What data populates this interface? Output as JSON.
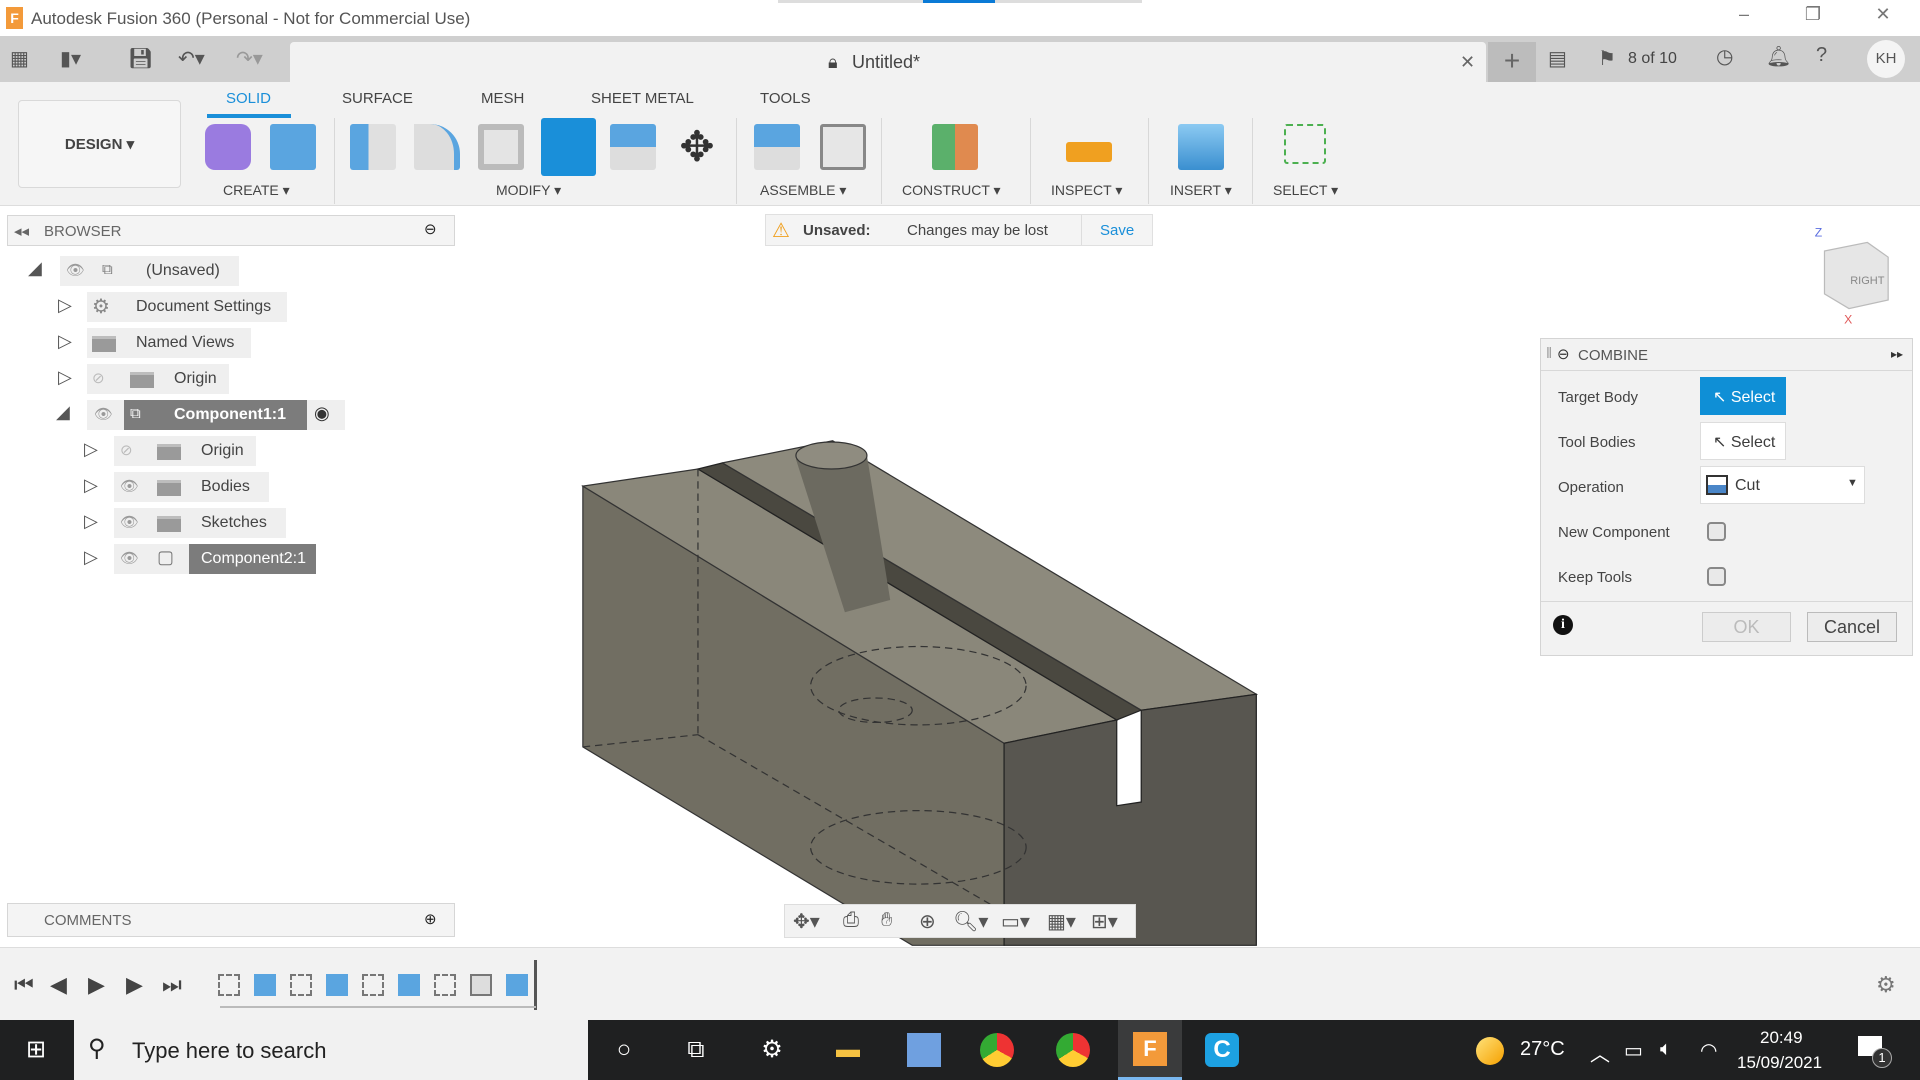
{
  "window": {
    "app_title": "Autodesk Fusion 360 (Personal - Not for Commercial Use)",
    "minimize": "–",
    "restore": "❐",
    "close": "✕"
  },
  "doc_tab": {
    "title": "Untitled*",
    "close": "✕",
    "jobs": "8 of 10",
    "user": "KH"
  },
  "workspace": "DESIGN ▾",
  "ribbon_tabs": [
    "SOLID",
    "SURFACE",
    "MESH",
    "SHEET METAL",
    "TOOLS"
  ],
  "groups": [
    "CREATE ▾",
    "MODIFY ▾",
    "ASSEMBLE ▾",
    "CONSTRUCT ▾",
    "INSPECT ▾",
    "INSERT ▾",
    "SELECT ▾"
  ],
  "browser": {
    "title": "BROWSER",
    "items": [
      {
        "label": "(Unsaved)"
      },
      {
        "label": "Document Settings"
      },
      {
        "label": "Named Views"
      },
      {
        "label": "Origin"
      },
      {
        "label": "Component1:1"
      },
      {
        "label": "Origin"
      },
      {
        "label": "Bodies"
      },
      {
        "label": "Sketches"
      },
      {
        "label": "Component2:1"
      }
    ]
  },
  "banner": {
    "status": "Unsaved:",
    "message": "Changes may be lost",
    "save": "Save"
  },
  "viewcube": {
    "face": "RIGHT",
    "z": "Z",
    "x": "X"
  },
  "combine": {
    "title": "COMBINE",
    "target_body": "Target Body",
    "tool_bodies": "Tool Bodies",
    "operation": "Operation",
    "new_component": "New Component",
    "keep_tools": "Keep Tools",
    "select": "Select",
    "operation_value": "Cut",
    "ok": "OK",
    "cancel": "Cancel",
    "new_component_checked": false,
    "keep_tools_checked": false
  },
  "comments": {
    "title": "COMMENTS"
  },
  "taskbar": {
    "search_placeholder": "Type here to search",
    "temperature": "27°C",
    "time": "20:49",
    "date": "15/09/2021",
    "notifications": "1"
  },
  "colors": {
    "accent": "#1a8fd9",
    "select_active": "#0f8fd6",
    "taskbar": "#1f2021"
  }
}
